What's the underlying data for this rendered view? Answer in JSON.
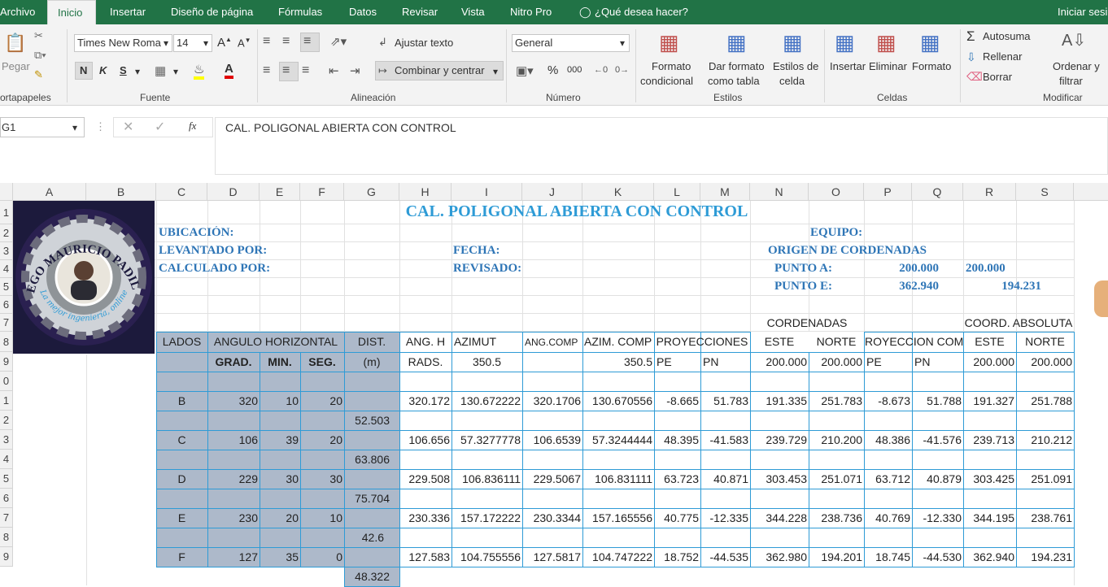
{
  "tabs": [
    "Archivo",
    "Inicio",
    "Insertar",
    "Diseño de página",
    "Fórmulas",
    "Datos",
    "Revisar",
    "Vista",
    "Nitro Pro"
  ],
  "tell_me": "¿Qué desea hacer?",
  "signin": "Iniciar sesi",
  "ribbon": {
    "paste_label": "Pegar",
    "font_name": "Times New Roma",
    "font_size": "14",
    "bold": "N",
    "italic": "K",
    "underline": "S",
    "wrap_text": "Ajustar texto",
    "merge_center": "Combinar y centrar",
    "number_format": "General",
    "percent": "%",
    "thousands": "000",
    "cond_format": [
      "Formato",
      "condicional"
    ],
    "format_table": [
      "Dar formato",
      "como tabla"
    ],
    "cell_styles": [
      "Estilos de",
      "celda"
    ],
    "insert": "Insertar",
    "delete": "Eliminar",
    "format": "Formato",
    "autosum": "Autosuma",
    "fill": "Rellenar",
    "clear": "Borrar",
    "sort_filter": [
      "Ordenar y",
      "filtrar"
    ],
    "groups": [
      "ortapapeles",
      "Fuente",
      "Alineación",
      "Número",
      "Estilos",
      "Celdas",
      "Modificar"
    ]
  },
  "formula_bar": {
    "name_box": "G1",
    "content": "CAL. POLIGONAL ABIERTA CON CONTROL"
  },
  "columns": [
    "A",
    "B",
    "C",
    "D",
    "E",
    "F",
    "G",
    "H",
    "I",
    "J",
    "K",
    "L",
    "M",
    "N",
    "O",
    "P",
    "Q",
    "R",
    "S"
  ],
  "rows": [
    "1",
    "2",
    "3",
    "4",
    "5",
    "6",
    "7",
    "8",
    "9",
    "0",
    "1",
    "2",
    "3",
    "4",
    "5",
    "6",
    "7",
    "8",
    "9"
  ],
  "logo": {
    "name": "DIEGO MAURICIO PADILLA",
    "tagline": "La mejor ingeniería, online"
  },
  "sheet": {
    "title": "CAL. POLIGONAL ABIERTA CON CONTROL",
    "ubicacion": "UBICACIÓN:",
    "equipo": "EQUIPO:",
    "levantado": "LEVANTADO POR:",
    "fecha": "FECHA:",
    "origen": "ORIGEN DE CORDENADAS",
    "calculado": "CALCULADO POR:",
    "revisado": "REVISADO:",
    "punto_a": "PUNTO A:",
    "punto_a_x": "200.000",
    "punto_a_y": "200.000",
    "punto_e": "PUNTO E:",
    "punto_e_x": "362.940",
    "punto_e_y": "194.231",
    "cordenadas": "CORDENADAS",
    "coord_abs": "COORD. ABSOLUTA",
    "h8": [
      "LADOS",
      "ANGULO HORIZONTAL",
      "DIST.",
      "ANG. H",
      "AZIMUT",
      "ANG.COMP",
      "AZIM. COMP",
      "PROYECCIONES",
      "ESTE",
      "NORTE",
      "ROYECCION COMP",
      "ESTE",
      "NORTE"
    ],
    "h9": [
      "GRAD.",
      "MIN.",
      "SEG.",
      "(m)",
      "RADS.",
      "350.5",
      "350.5",
      "PE",
      "PN",
      "200.000",
      "200.000",
      "PE",
      "PN",
      "200.000",
      "200.000"
    ],
    "stations": [
      {
        "lado": "B",
        "grad": "320",
        "min": "10",
        "seg": "20",
        "angh": "320.172",
        "az": "130.672222",
        "angc": "320.1706",
        "azc": "130.670556",
        "pe": "-8.665",
        "pn": "51.783",
        "este": "191.335",
        "norte": "251.783",
        "pe2": "-8.673",
        "pn2": "51.788",
        "este2": "191.327",
        "norte2": "251.788"
      },
      {
        "lado": "C",
        "grad": "106",
        "min": "39",
        "seg": "20",
        "angh": "106.656",
        "az": "57.3277778",
        "angc": "106.6539",
        "azc": "57.3244444",
        "pe": "48.395",
        "pn": "-41.583",
        "este": "239.729",
        "norte": "210.200",
        "pe2": "48.386",
        "pn2": "-41.576",
        "este2": "239.713",
        "norte2": "210.212"
      },
      {
        "lado": "D",
        "grad": "229",
        "min": "30",
        "seg": "30",
        "angh": "229.508",
        "az": "106.836111",
        "angc": "229.5067",
        "azc": "106.831111",
        "pe": "63.723",
        "pn": "40.871",
        "este": "303.453",
        "norte": "251.071",
        "pe2": "63.712",
        "pn2": "40.879",
        "este2": "303.425",
        "norte2": "251.091"
      },
      {
        "lado": "E",
        "grad": "230",
        "min": "20",
        "seg": "10",
        "angh": "230.336",
        "az": "157.172222",
        "angc": "230.3344",
        "azc": "157.165556",
        "pe": "40.775",
        "pn": "-12.335",
        "este": "344.228",
        "norte": "238.736",
        "pe2": "40.769",
        "pn2": "-12.330",
        "este2": "344.195",
        "norte2": "238.761"
      },
      {
        "lado": "F",
        "grad": "127",
        "min": "35",
        "seg": "0",
        "angh": "127.583",
        "az": "104.755556",
        "angc": "127.5817",
        "azc": "104.747222",
        "pe": "18.752",
        "pn": "-44.535",
        "este": "362.980",
        "norte": "194.201",
        "pe2": "18.745",
        "pn2": "-44.530",
        "este2": "362.940",
        "norte2": "194.231"
      }
    ],
    "distances": [
      "52.503",
      "63.806",
      "75.704",
      "42.6",
      "48.322"
    ]
  }
}
